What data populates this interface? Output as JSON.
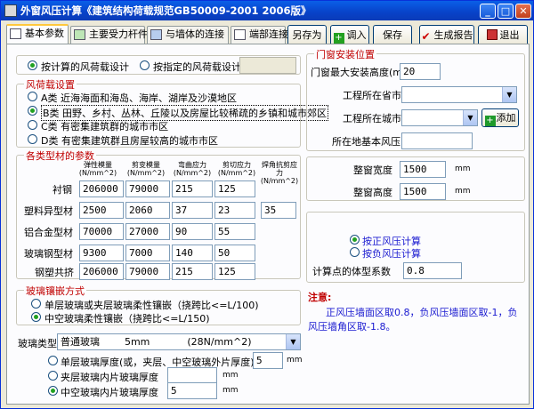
{
  "window": {
    "title": "外窗风压计算《建筑结构荷载规范GB50009-2001 2006版》"
  },
  "title_buttons": {
    "minimize": "_",
    "maximize": "□",
    "close": "✕"
  },
  "tabs": [
    "基本参数",
    "主要受力杆件",
    "与墙体的连接",
    "端部连接"
  ],
  "toolbar": {
    "save_as": "另存为",
    "load": "调入",
    "save": "保存",
    "report": "生成报告",
    "exit": "退出"
  },
  "wind": {
    "mode_options": [
      "按计算的风荷载设计",
      "按指定的风荷载设计"
    ],
    "section_title": "风荷载设置",
    "terrain_options": [
      "A类 近海海面和海岛、海岸、湖岸及沙漠地区",
      "B类 田野、乡村、丛林、丘陵以及房屋比较稀疏的乡镇和城市郊区",
      "C类 有密集建筑群的城市市区",
      "D类 有密集建筑群且房屋较高的城市市区"
    ],
    "selected_terrain": 1
  },
  "materials": {
    "section_title": "各类型材的参数",
    "headers": [
      "弹性模量\n(N/mm^2)",
      "剪变模量\n(N/mm^2)",
      "弯曲应力\n(N/mm^2)",
      "剪切应力\n(N/mm^2)",
      "焊角抗剪应\n力(N/mm^2)"
    ],
    "rows": [
      {
        "name": "衬钢",
        "values": [
          "206000",
          "79000",
          "215",
          "125",
          ""
        ]
      },
      {
        "name": "塑料异型材",
        "values": [
          "2500",
          "2060",
          "37",
          "23",
          "35"
        ]
      },
      {
        "name": "铝合金型材",
        "values": [
          "70000",
          "27000",
          "90",
          "55",
          ""
        ]
      },
      {
        "name": "玻璃钢型材",
        "values": [
          "9300",
          "7000",
          "140",
          "50",
          ""
        ]
      },
      {
        "name": "钢塑共挤",
        "values": [
          "206000",
          "79000",
          "215",
          "125",
          ""
        ]
      }
    ]
  },
  "glass_install": {
    "section_title": "玻璃镶嵌方式",
    "options": [
      "单层玻璃或夹层玻璃柔性镶嵌（挠跨比<=L/100)",
      "中空玻璃柔性镶嵌（挠跨比<=L/150)"
    ],
    "selected": 1
  },
  "glass": {
    "type_label": "玻璃类型",
    "type_value": "普通玻璃        5mm            (28N/mm^2)",
    "options": [
      "单层玻璃厚度(或，夹层、中空玻璃外片厚度)",
      "夹层玻璃内片玻璃厚度",
      "中空玻璃内片玻璃厚度"
    ],
    "values": [
      "5",
      "",
      "5"
    ],
    "unit": "mm"
  },
  "install_pos": {
    "section_title": "门窗安装位置",
    "height_label": "门窗最大安装高度(m",
    "height_value": "20",
    "province_label": "工程所在省市",
    "city_label": "工程所在城市",
    "add_label": "添加",
    "base_pressure_label": "所在地基本风压"
  },
  "size": {
    "width_label": "整窗宽度",
    "width_value": "1500",
    "height_label": "整窗高度",
    "height_value": "1500",
    "unit": "mm"
  },
  "calc": {
    "options": [
      "按正风压计算",
      "按负风压计算"
    ],
    "shape_label": "计算点的体型系数",
    "shape_value": "0.8"
  },
  "note": {
    "title": "注意:",
    "text": "正风压墙面区取0.8，负风压墙面区取-1，负风压墙角区取-1.8。"
  }
}
